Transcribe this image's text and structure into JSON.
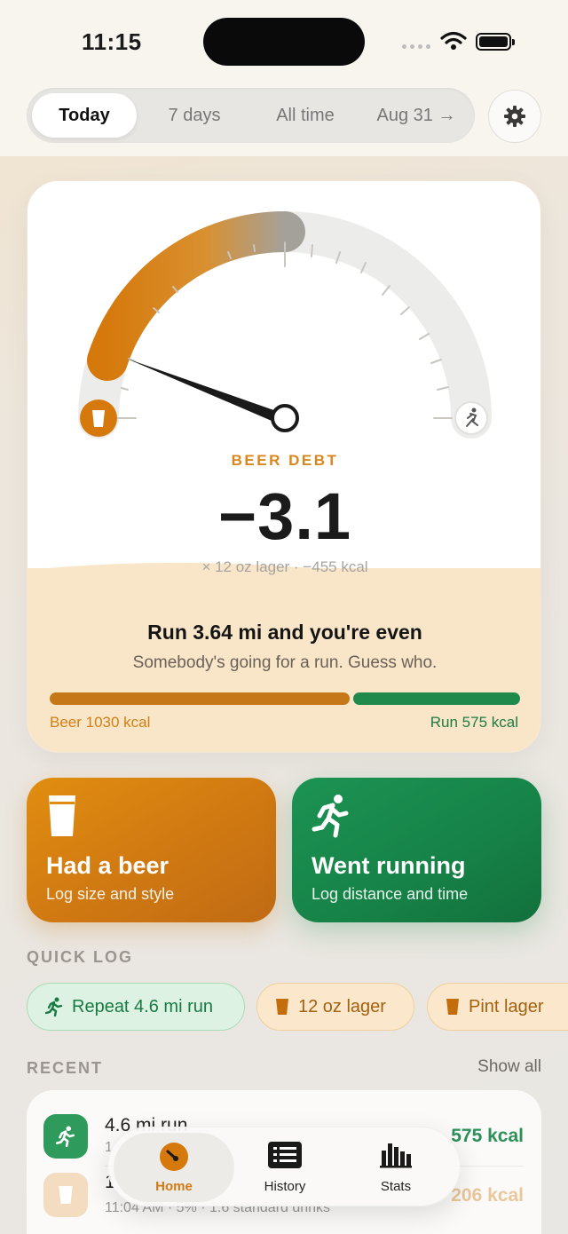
{
  "status_bar": {
    "time": "11:15"
  },
  "range_tabs": [
    {
      "label": "Today",
      "active": true
    },
    {
      "label": "7 days",
      "active": false
    },
    {
      "label": "All time",
      "active": false
    },
    {
      "label": "Aug 31 →",
      "active": false
    }
  ],
  "settings_icon": "gear-icon",
  "gauge": {
    "label": "BEER DEBT",
    "value": "−3.1",
    "subtitle": "× 12 oz lager · −455 kcal",
    "needle_fraction": 0.1
  },
  "balance": {
    "title": "Run 3.64 mi and you're even",
    "subtitle": "Somebody's going for a run. Guess who.",
    "beer_label": "Beer 1030 kcal",
    "run_label": "Run 575 kcal",
    "beer_kcal": 1030,
    "run_kcal": 575
  },
  "actions": {
    "beer": {
      "title": "Had a beer",
      "subtitle": "Log size and style"
    },
    "run": {
      "title": "Went running",
      "subtitle": "Log distance and time"
    }
  },
  "quick_log": {
    "heading": "QUICK LOG",
    "chips": [
      "Repeat 4.6 mi run",
      "12 oz lager",
      "Pint lager"
    ]
  },
  "recent": {
    "heading": "RECENT",
    "show_all": "Show all",
    "items": [
      {
        "title": "4.6 mi run",
        "subtitle": "1",
        "value": "575 kcal"
      },
      {
        "title": "1",
        "subtitle": "11:04 AM · 5% · 1.6 standard drinks",
        "value": "206 kcal"
      }
    ]
  },
  "tab_bar": [
    {
      "label": "Home",
      "active": true
    },
    {
      "label": "History",
      "active": false
    },
    {
      "label": "Stats",
      "active": false
    }
  ],
  "colors": {
    "beer": "#d17a12",
    "run": "#1f8a4c",
    "accent_label": "#d9861c"
  }
}
